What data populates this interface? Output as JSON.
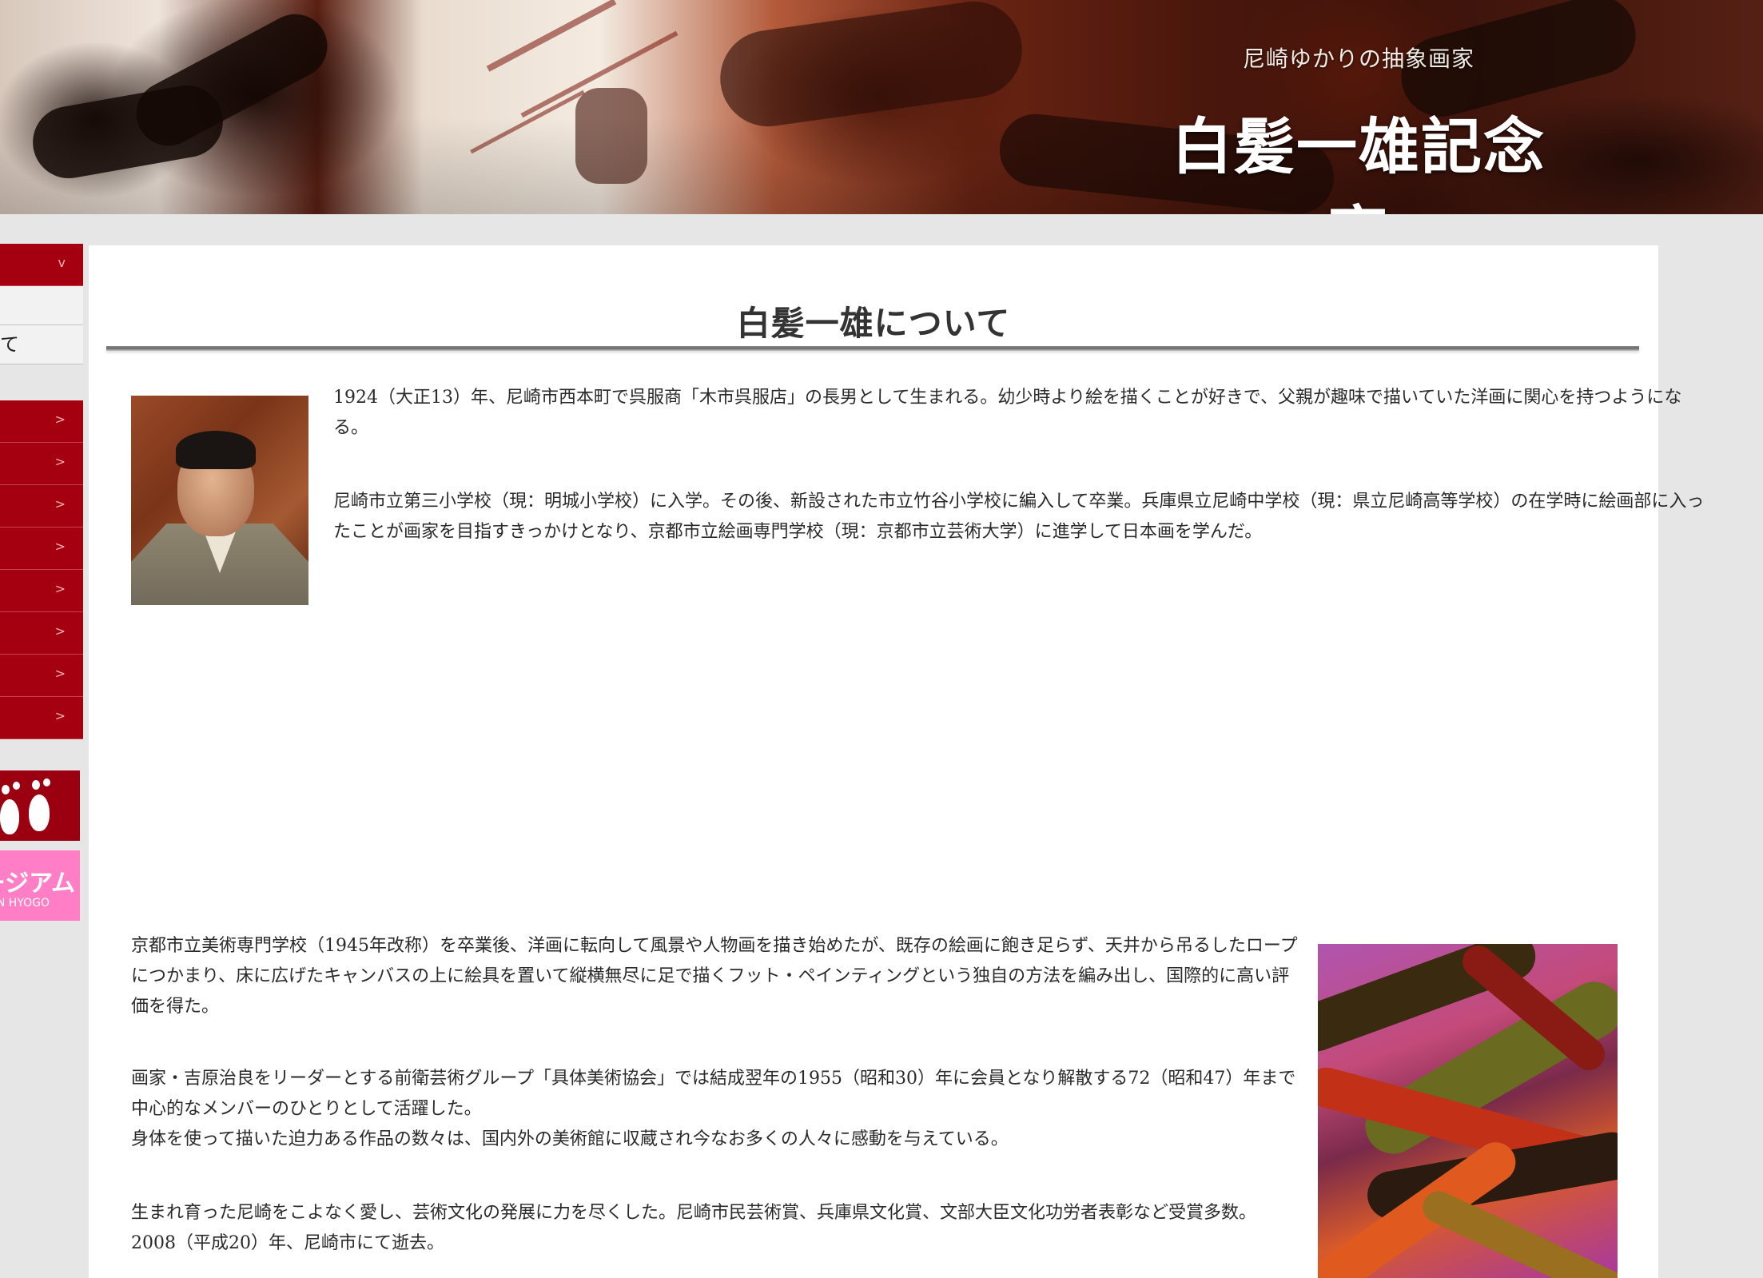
{
  "header": {
    "subtitle": "尼崎ゆかりの抽象画家",
    "site_title": "白髪一雄記念室"
  },
  "sidebar": {
    "top_item_chevron": "v",
    "sub_items": [
      {
        "label": ""
      },
      {
        "label": "て"
      }
    ],
    "items_chevron": ">",
    "items_count": 8,
    "ashi_banner_icon": "footprints-icon",
    "museum_banner": {
      "name": "ージアム",
      "sub": "N HYOGO"
    }
  },
  "main": {
    "page_title": "白髪一雄について",
    "paragraphs": [
      "1924（大正13）年、尼崎市西本町で呉服商「木市呉服店」の長男として生まれる。幼少時より絵を描くことが好きで、父親が趣味で描いていた洋画に関心を持つようになる。",
      "尼崎市立第三小学校（現：明城小学校）に入学。その後、新設された市立竹谷小学校に編入して卒業。兵庫県立尼崎中学校（現：県立尼崎高等学校）の在学時に絵画部に入ったことが画家を目指すきっかけとなり、京都市立絵画専門学校（現：京都市立芸術大学）に進学して日本画を学んだ。",
      "京都市立美術専門学校（1945年改称）を卒業後、洋画に転向して風景や人物画を描き始めたが、既存の絵画に飽き足らず、天井から吊るしたロープにつかまり、床に広げたキャンバスの上に絵具を置いて縦横無尽に足で描くフット・ペインティングという独自の方法を編み出し、国際的に高い評価を得た。",
      "画家・吉原治良をリーダーとする前衛芸術グループ「具体美術協会」では結成翌年の1955（昭和30）年に会員となり解散する72（昭和47）年まで中心的なメンバーのひとりとして活躍した。",
      "身体を使って描いた迫力ある作品の数々は、国内外の美術館に収蔵され今なお多くの人々に感動を与えている。",
      "生まれ育った尼崎をこよなく愛し、芸術文化の発展に力を尽くした。尼崎市民芸術賞、兵庫県文化賞、文部大臣文化功労者表彰など受賞多数。2008（平成20）年、尼崎市にて逝去。"
    ]
  },
  "colors": {
    "menu_red": "#a40010",
    "page_bg": "#e6e6e6",
    "museum_pink": "#ff7ec6"
  }
}
